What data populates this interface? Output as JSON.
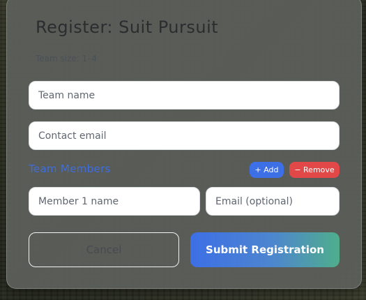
{
  "modal": {
    "title": "Register: Suit Pursuit",
    "team_size": "Team size: 1–4"
  },
  "fields": {
    "team_name_placeholder": "Team name",
    "contact_email_placeholder": "Contact email",
    "member_name_placeholder": "Member 1 name",
    "member_email_placeholder": "Email (optional)"
  },
  "members": {
    "section_label": "Team Members",
    "add_label": "+ Add",
    "remove_label": "− Remove"
  },
  "actions": {
    "cancel_label": "Cancel",
    "submit_label": "Submit Registration"
  },
  "colors": {
    "accent_blue": "#3d6fe6",
    "remove_red": "#e34848",
    "submit_gradient_end": "#4fae8c"
  }
}
